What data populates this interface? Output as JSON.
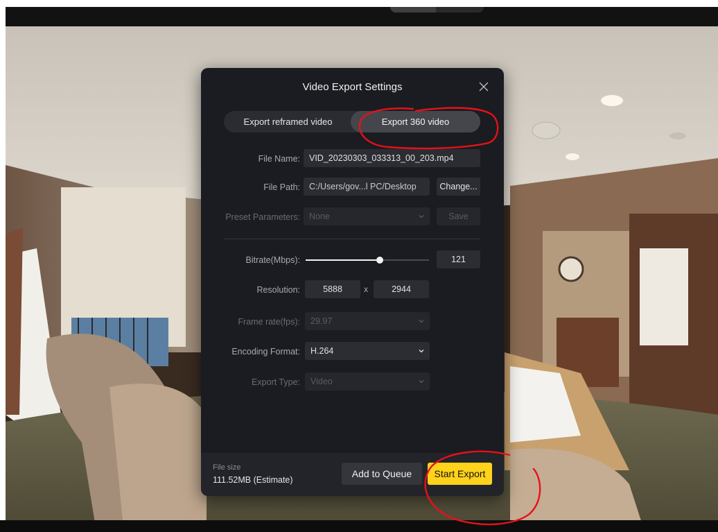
{
  "dialog": {
    "title": "Video Export Settings",
    "tabs": [
      {
        "label": "Export reframed video",
        "active": false
      },
      {
        "label": "Export 360 video",
        "active": true
      }
    ],
    "file_name": {
      "label": "File Name:",
      "value": "VID_20230303_033313_00_203.mp4"
    },
    "file_path": {
      "label": "File Path:",
      "value": "C:/Users/gov...l PC/Desktop",
      "button": "Change..."
    },
    "preset": {
      "label": "Preset Parameters:",
      "value": "None",
      "button": "Save",
      "enabled": false
    },
    "bitrate": {
      "label": "Bitrate(Mbps):",
      "value": "121",
      "slider_fraction": 0.6
    },
    "resolution": {
      "label": "Resolution:",
      "width": "5888",
      "separator": "x",
      "height": "2944"
    },
    "frame_rate": {
      "label": "Frame rate(fps):",
      "value": "29.97",
      "enabled": false
    },
    "encoding": {
      "label": "Encoding Format:",
      "value": "H.264",
      "enabled": true
    },
    "export_type": {
      "label": "Export Type:",
      "value": "Video",
      "enabled": false
    },
    "footer": {
      "file_size_label": "File size",
      "file_size_value": "111.52MB (Estimate)",
      "queue_button": "Add to Queue",
      "export_button": "Start Export"
    }
  },
  "colors": {
    "accent": "#ffd21c",
    "annotation": "#e8101a",
    "dialog_bg": "#1b1c21"
  },
  "icons": {
    "close": "close-icon",
    "dropdown": "chevron-down-icon"
  }
}
